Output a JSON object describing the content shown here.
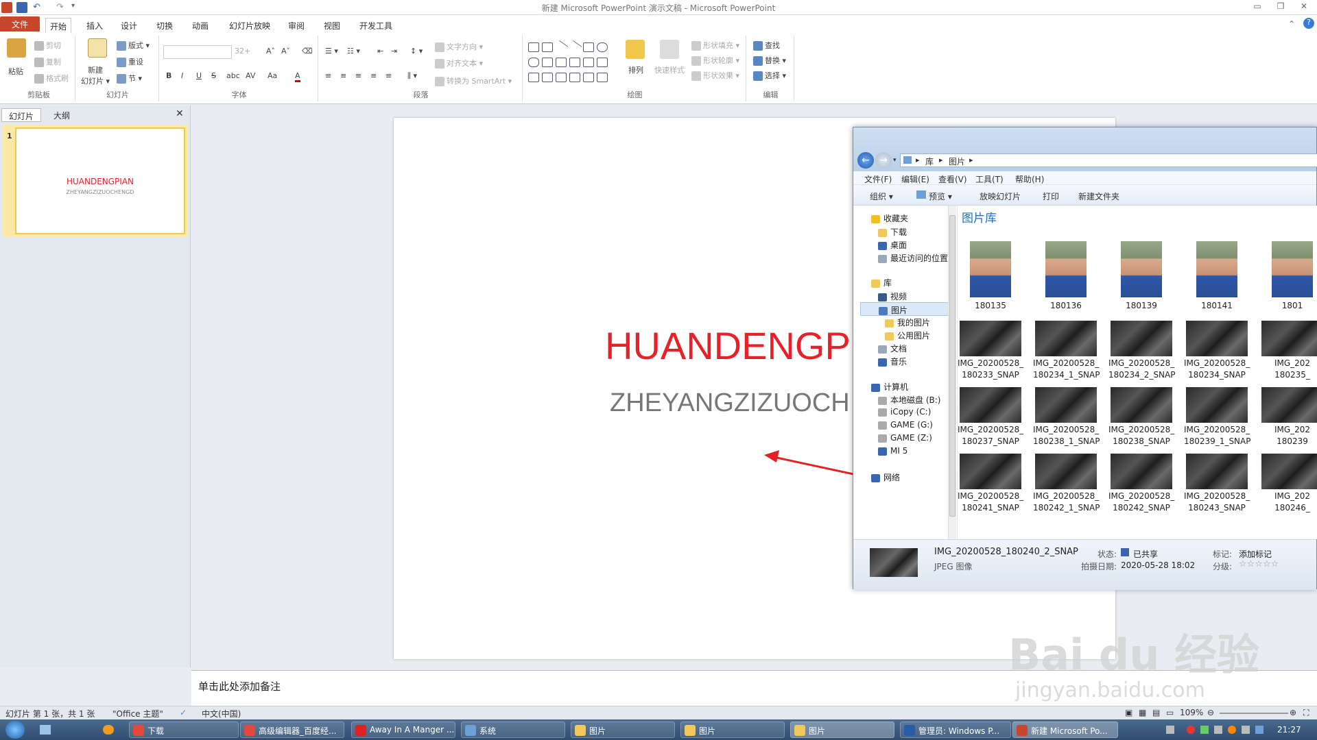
{
  "window": {
    "title": "新建 Microsoft PowerPoint 演示文稿 - Microsoft PowerPoint",
    "min": "▭",
    "restore": "❐",
    "close": "✕"
  },
  "tabs": [
    {
      "label": "文件"
    },
    {
      "label": "开始"
    },
    {
      "label": "插入"
    },
    {
      "label": "设计"
    },
    {
      "label": "切换"
    },
    {
      "label": "动画"
    },
    {
      "label": "幻灯片放映"
    },
    {
      "label": "审阅"
    },
    {
      "label": "视图"
    },
    {
      "label": "开发工具"
    }
  ],
  "ribbon": {
    "clipboard": {
      "label": "剪贴板",
      "paste": "粘贴",
      "cut": "剪切",
      "copy": "复制",
      "format": "格式刷"
    },
    "slides": {
      "label": "幻灯片",
      "new_slide_line1": "新建",
      "new_slide_line2": "幻灯片 ▾",
      "layout": "版式 ▾",
      "reset": "重设",
      "section": "节 ▾"
    },
    "font": {
      "label": "字体",
      "size": "32+",
      "bold": "B",
      "italic": "I",
      "underline": "U",
      "strike": "S",
      "shadow": "abc",
      "spacing": "AV",
      "case": "Aa",
      "color": "A"
    },
    "paragraph": {
      "label": "段落",
      "text_dir": "文字方向 ▾",
      "align_text": "对齐文本 ▾",
      "smartart": "转换为 SmartArt ▾"
    },
    "drawing": {
      "label": "绘图",
      "arrange": "排列",
      "quick_styles": "快速样式",
      "fill": "形状填充 ▾",
      "outline": "形状轮廓 ▾",
      "effects": "形状效果 ▾"
    },
    "editing": {
      "label": "编辑",
      "find": "查找",
      "replace": "替换 ▾",
      "select": "选择 ▾"
    }
  },
  "left_pane": {
    "tab_slides": "幻灯片",
    "tab_outline": "大纲",
    "close": "✕",
    "slide_number": "1",
    "thumb_title": "HUANDENGPIAN",
    "thumb_subtitle": "ZHEYANGZIZUOCHENGD"
  },
  "slide": {
    "title": "HUANDENGPIA",
    "subtitle": "ZHEYANGZIZUOCH",
    "title_color": "#e8202a"
  },
  "notes": {
    "placeholder": "单击此处添加备注"
  },
  "status": {
    "slide_info": "幻灯片 第 1 张，共 1 张",
    "theme": "\"Office 主题\"",
    "language": "中文(中国)",
    "zoom": "109%"
  },
  "explorer": {
    "breadcrumb": [
      "库",
      "图片"
    ],
    "menu": [
      "文件(F)",
      "编辑(E)",
      "查看(V)",
      "工具(T)",
      "帮助(H)"
    ],
    "toolbar": [
      "组织 ▾",
      "预览 ▾",
      "放映幻灯片",
      "打印",
      "新建文件夹"
    ],
    "nav": {
      "favorites": "收藏夹",
      "downloads": "下载",
      "desktop": "桌面",
      "recent": "最近访问的位置",
      "libraries": "库",
      "videos": "视频",
      "pictures": "图片",
      "my_pictures": "我的图片",
      "public_pictures": "公用图片",
      "documents": "文档",
      "music": "音乐",
      "computer": "计算机",
      "drive_b": "本地磁盘 (B:)",
      "drive_c": "iCopy (C:)",
      "drive_g": "GAME (G:)",
      "drive_z": "GAME (Z:)",
      "mi5": "MI 5",
      "network": "网络"
    },
    "library_title": "图片库",
    "portraits": [
      "180135",
      "180136",
      "180139",
      "180141",
      "1801"
    ],
    "rows": [
      [
        [
          "IMG_20200528_",
          "180233_SNAP"
        ],
        [
          "IMG_20200528_",
          "180234_1_SNAP"
        ],
        [
          "IMG_20200528_",
          "180234_2_SNAP"
        ],
        [
          "IMG_20200528_",
          "180234_SNAP"
        ],
        [
          "IMG_202",
          "180235_"
        ]
      ],
      [
        [
          "IMG_20200528_",
          "180237_SNAP"
        ],
        [
          "IMG_20200528_",
          "180238_1_SNAP"
        ],
        [
          "IMG_20200528_",
          "180238_SNAP"
        ],
        [
          "IMG_20200528_",
          "180239_1_SNAP"
        ],
        [
          "IMG_202",
          "180239"
        ]
      ],
      [
        [
          "IMG_20200528_",
          "180241_SNAP"
        ],
        [
          "IMG_20200528_",
          "180242_1_SNAP"
        ],
        [
          "IMG_20200528_",
          "180242_SNAP"
        ],
        [
          "IMG_20200528_",
          "180243_SNAP"
        ],
        [
          "IMG_202",
          "180246_"
        ]
      ]
    ],
    "details": {
      "filename": "IMG_20200528_180240_2_SNAP",
      "type": "JPEG 图像",
      "state_label": "状态:",
      "state_value": "已共享",
      "date_label": "拍摄日期:",
      "date_value": "2020-05-28 18:02",
      "tag_label": "标记:",
      "tag_value": "添加标记",
      "rating_label": "分级:",
      "rating_value": "☆☆☆☆☆"
    }
  },
  "taskbar": {
    "items": [
      "下载",
      "高级编辑器_百度经...",
      "Away In A Manger ...",
      "系统",
      "图片",
      "图片",
      "图片",
      "管理员: Windows P...",
      "新建 Microsoft Po..."
    ],
    "time": "21:27"
  },
  "watermark": {
    "line1": "Bai du 经验",
    "line2": "jingyan.baidu.com"
  }
}
